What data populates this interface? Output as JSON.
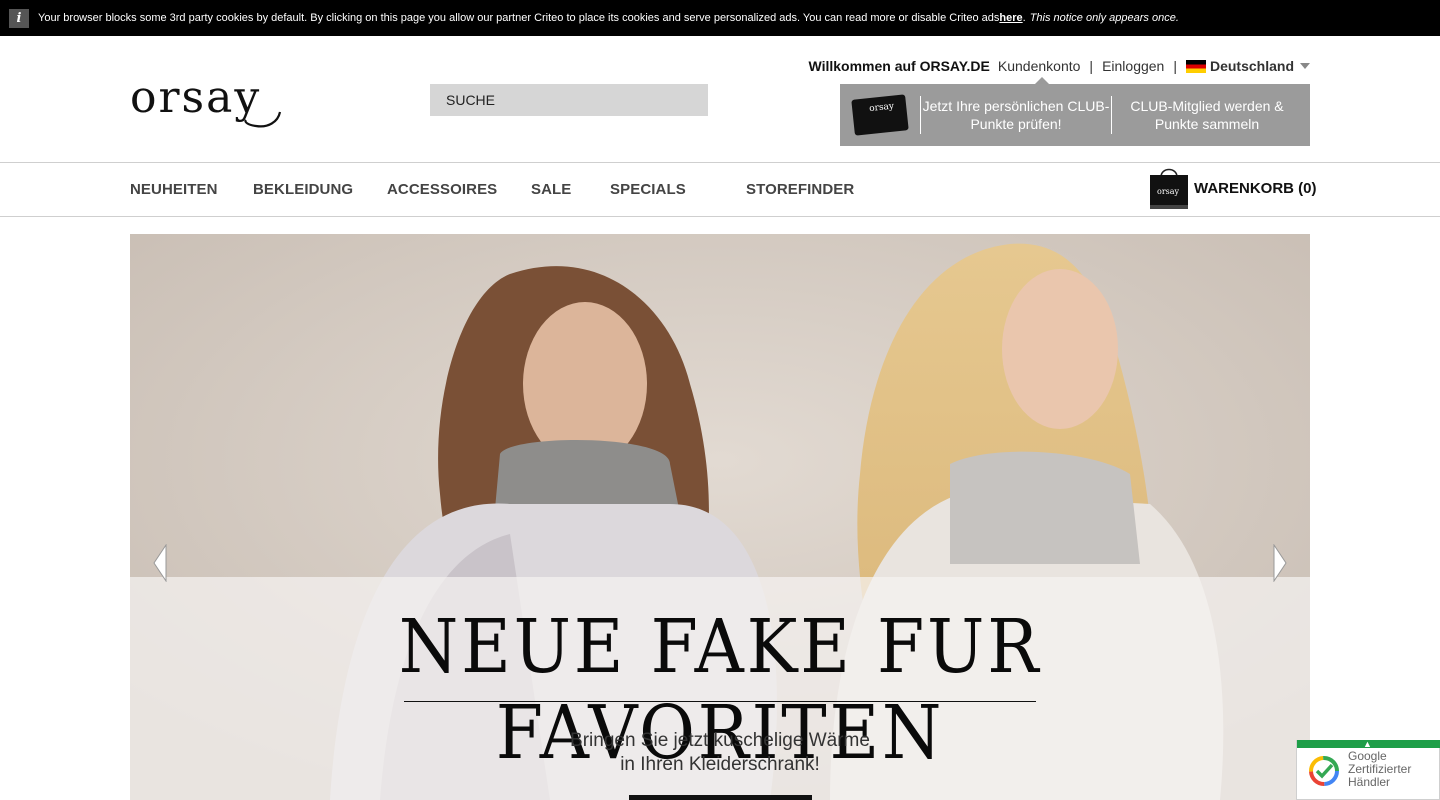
{
  "cookie_bar": {
    "info_icon": "i",
    "text": "Your browser blocks some 3rd party cookies by default. By clicking on this page you allow our partner Criteo to place its cookies and serve personalized ads. You can read more or disable Criteo ads",
    "link": "here",
    "after_link": ".",
    "note": "This notice only appears once."
  },
  "header": {
    "logo_text": "orsay",
    "search_placeholder": "SUCHE",
    "welcome": "Willkommen auf ORSAY.DE",
    "account_link": "Kundenkonto",
    "separator": "|",
    "login_link": "Einloggen",
    "country": "Deutschland"
  },
  "club": {
    "card_text": "orsay",
    "check_points": "Jetzt Ihre persönlichen CLUB-Punkte prüfen!",
    "join": "CLUB-Mitglied werden & Punkte sammeln"
  },
  "nav": {
    "items": [
      "NEUHEITEN",
      "BEKLEIDUNG",
      "ACCESSOIRES",
      "SALE",
      "SPECIALS",
      "STOREFINDER"
    ],
    "cart_bag_text": "orsay",
    "cart_label": "WARENKORB (0)"
  },
  "hero": {
    "headline": "NEUE FAKE FUR FAVORITEN",
    "subline_1": "Bringen Sie jetzt kuschelige Wärme",
    "subline_2": "in Ihren Kleiderschrank!"
  },
  "badge": {
    "line1": "Google",
    "line2": "Zertifizierter",
    "line3": "Händler",
    "accent": "#1e9e48"
  }
}
